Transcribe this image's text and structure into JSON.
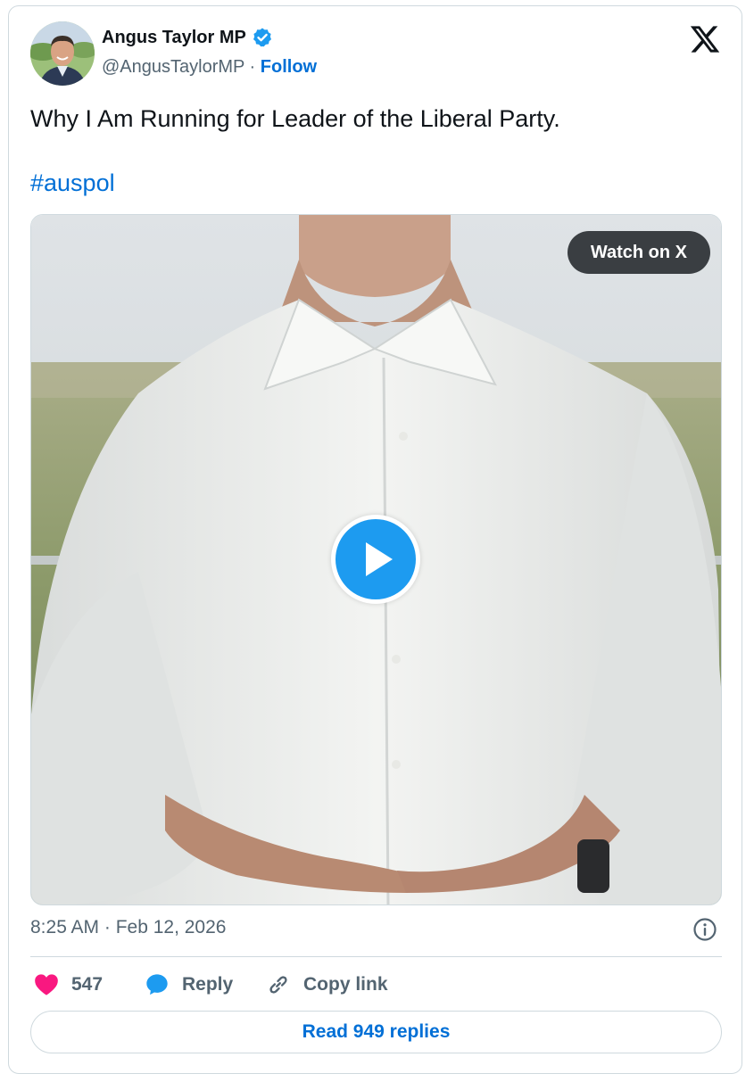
{
  "author": {
    "display_name": "Angus Taylor MP",
    "handle": "@AngusTaylorMP",
    "separator": " · ",
    "follow_label": "Follow",
    "verified": true
  },
  "tweet": {
    "text": "Why I Am Running for Leader of the Liberal Party.",
    "hashtag": "#auspol",
    "timestamp": "8:25 AM · Feb 12, 2026"
  },
  "media": {
    "watch_label": "Watch on X"
  },
  "actions": {
    "like_count": "547",
    "reply_label": "Reply",
    "copy_label": "Copy link",
    "read_replies_label": "Read 949 replies"
  },
  "colors": {
    "accent": "#1d9bf0",
    "link": "#006fd6",
    "like": "#f91880",
    "muted": "#536471"
  },
  "icons": [
    "verified-badge-icon",
    "x-logo-icon",
    "play-icon",
    "info-icon",
    "heart-icon",
    "reply-bubble-icon",
    "link-icon"
  ]
}
